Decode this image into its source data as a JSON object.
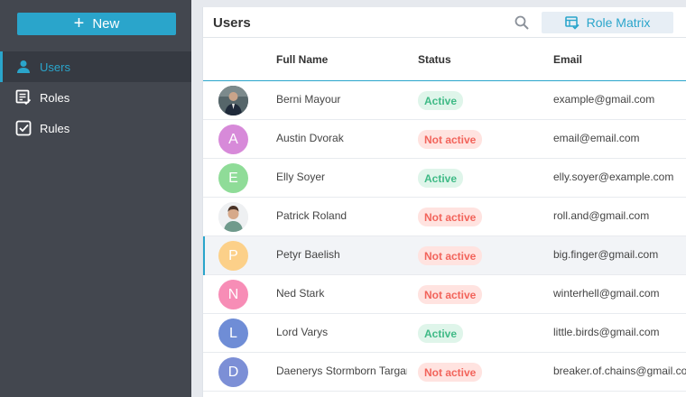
{
  "sidebar": {
    "new_button": {
      "icon": "plus-icon",
      "label": "New"
    },
    "items": [
      {
        "label": "Users",
        "icon": "user-icon",
        "active": true
      },
      {
        "label": "Roles",
        "icon": "roles-list-icon",
        "active": false
      },
      {
        "label": "Rules",
        "icon": "rules-check-icon",
        "active": false
      }
    ]
  },
  "toolbar": {
    "title": "Users",
    "search_icon": "search-icon",
    "role_matrix_label": "Role Matrix",
    "role_matrix_icon": "table-check-icon"
  },
  "table": {
    "columns": [
      "Full Name",
      "Status",
      "Email"
    ],
    "rows": [
      {
        "avatar": "photo",
        "initial": "",
        "name": "Berni Mayour",
        "status": "Active",
        "email": "example@gmail.com"
      },
      {
        "avatar": "letter",
        "initial": "A",
        "name": "Austin Dvorak",
        "status": "Not active",
        "email": "email@email.com"
      },
      {
        "avatar": "letter",
        "initial": "E",
        "name": "Elly Soyer",
        "status": "Active",
        "email": "elly.soyer@example.com"
      },
      {
        "avatar": "photo",
        "initial": "",
        "name": "Patrick Roland",
        "status": "Not active",
        "email": "roll.and@gmail.com"
      },
      {
        "avatar": "letter",
        "initial": "P",
        "name": "Petyr Baelish",
        "status": "Not active",
        "email": "big.finger@gmail.com"
      },
      {
        "avatar": "letter",
        "initial": "N",
        "name": "Ned Stark",
        "status": "Not active",
        "email": "winterhell@gmail.com"
      },
      {
        "avatar": "letter",
        "initial": "L",
        "name": "Lord Varys",
        "status": "Active",
        "email": "little.birds@gmail.com"
      },
      {
        "avatar": "letter",
        "initial": "D",
        "name": "Daenerys Stormborn Targaryen",
        "status": "Not active",
        "email": "breaker.of.chains@gmail.com"
      }
    ],
    "selected_row": 4
  },
  "colors": {
    "accent": "#2aa5cb",
    "sidebar_bg": "#43474f",
    "active_badge_bg": "#dff5ea",
    "active_badge_text": "#3fba86",
    "inactive_badge_bg": "#ffe3e0",
    "inactive_badge_text": "#f2645b",
    "avatar_A": "#d78ad9",
    "avatar_E": "#8fdc98",
    "avatar_P": "#fcd089",
    "avatar_N": "#f78db6",
    "avatar_L": "#6f8dd6",
    "avatar_D": "#7c8fd6"
  }
}
